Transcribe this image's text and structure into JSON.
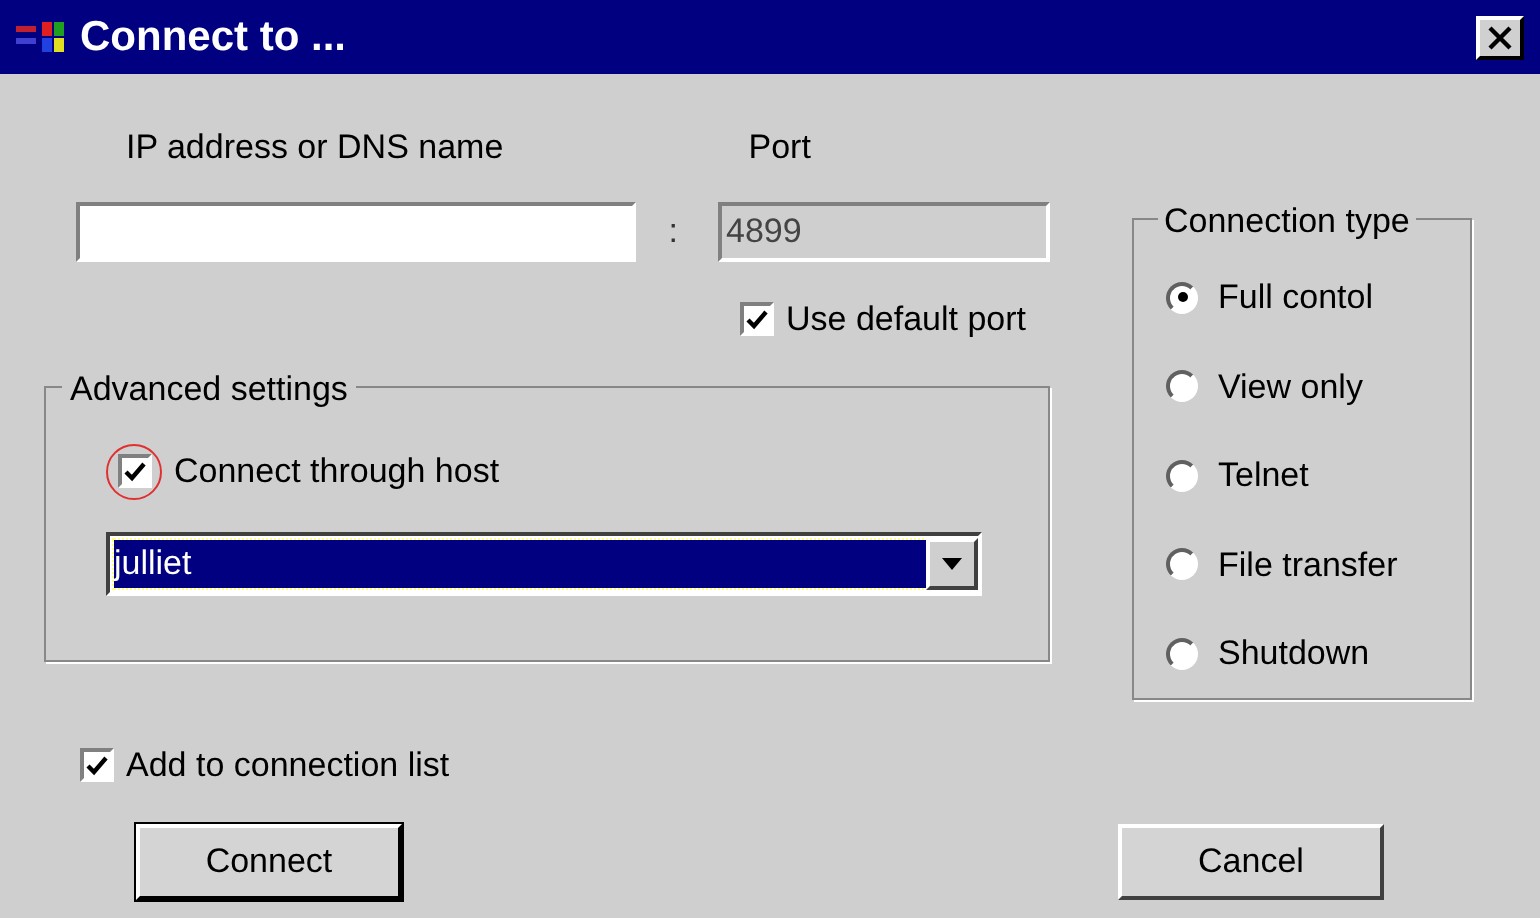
{
  "window": {
    "title": "Connect to ..."
  },
  "address": {
    "label": "IP address or DNS name"
  },
  "separator": ":",
  "port": {
    "label": "Port",
    "value": "4899",
    "disabled": true
  },
  "use_default_port": {
    "label": "Use default port",
    "checked": true
  },
  "advanced": {
    "title": "Advanced settings",
    "connect_through_host": {
      "label": "Connect through host",
      "checked": true,
      "circled": true
    },
    "host": {
      "value": "julliet",
      "selected": true
    }
  },
  "add_to_list": {
    "label": "Add to connection list",
    "checked": true
  },
  "connection_type": {
    "title": "Connection type",
    "options": [
      {
        "label": "Full contol",
        "selected": true
      },
      {
        "label": "View only",
        "selected": false
      },
      {
        "label": "Telnet",
        "selected": false
      },
      {
        "label": "File transfer",
        "selected": false
      },
      {
        "label": "Shutdown",
        "selected": false
      }
    ]
  },
  "buttons": [
    {
      "label": "Connect",
      "default": true
    },
    {
      "label": "Cancel",
      "default": false
    }
  ]
}
